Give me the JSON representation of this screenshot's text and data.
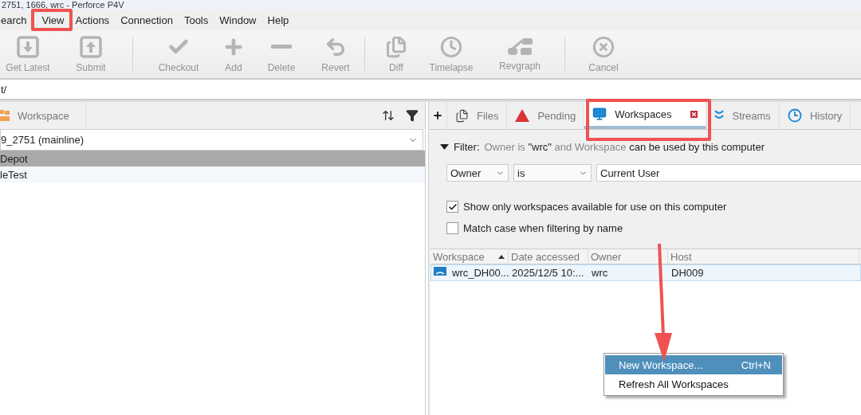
{
  "window": {
    "title": "2751, 1666, wrc - Perforce P4V"
  },
  "menu": [
    {
      "label": "earch",
      "annotated": false
    },
    {
      "label": "View",
      "annotated": true
    },
    {
      "label": "Actions",
      "annotated": false
    },
    {
      "label": "Connection",
      "annotated": false
    },
    {
      "label": "Tools",
      "annotated": false
    },
    {
      "label": "Window",
      "annotated": false
    },
    {
      "label": "Help",
      "annotated": false
    }
  ],
  "toolbar": [
    {
      "kind": "getlatest",
      "label": "Get Latest",
      "disabled": true
    },
    {
      "kind": "submit",
      "label": "Submit",
      "disabled": true
    },
    {
      "kind": "separator"
    },
    {
      "kind": "checkout",
      "label": "Checkout",
      "disabled": true
    },
    {
      "kind": "add",
      "label": "Add",
      "disabled": true
    },
    {
      "kind": "delete",
      "label": "Delete",
      "disabled": true
    },
    {
      "kind": "revert",
      "label": "Revert",
      "disabled": true
    },
    {
      "kind": "separator"
    },
    {
      "kind": "diff",
      "label": "Diff",
      "disabled": true
    },
    {
      "kind": "timelapse",
      "label": "Timelapse",
      "disabled": true
    },
    {
      "kind": "revgraph",
      "label": "Revgraph",
      "disabled": true
    },
    {
      "kind": "separator"
    },
    {
      "kind": "cancel",
      "label": "Cancel",
      "disabled": true
    }
  ],
  "address": {
    "value": "t/"
  },
  "left_pane": {
    "tab": "Workspace",
    "workspace_select": "9_2751 (mainline)",
    "tree": [
      {
        "label": "Depot",
        "selected": true
      },
      {
        "label": "leTest",
        "selected": false
      }
    ]
  },
  "right_pane": {
    "tabs": [
      {
        "kind": "files",
        "label": "Files",
        "selected": false,
        "annotated": false
      },
      {
        "kind": "pending",
        "label": "Pending",
        "selected": false,
        "annotated": false
      },
      {
        "kind": "workspaces",
        "label": "Workspaces",
        "selected": true,
        "annotated": true
      },
      {
        "kind": "streams",
        "label": "Streams",
        "selected": false,
        "annotated": false
      },
      {
        "kind": "history",
        "label": "History",
        "selected": false,
        "annotated": false
      }
    ],
    "filter": {
      "label": "Filter:",
      "expanded": true,
      "description": [
        {
          "text": "Owner is ",
          "dim": true
        },
        {
          "text": "\"wrc\"",
          "dim": false
        },
        {
          "text": " and Workspace ",
          "dim": true
        },
        {
          "text": "can be used by this computer",
          "dim": false
        }
      ],
      "field": "Owner",
      "operator": "is",
      "value": "Current User",
      "options": [
        {
          "label": "Show only workspaces available for use on this computer",
          "checked": true
        },
        {
          "label": "Match case when filtering by name",
          "checked": false
        }
      ]
    },
    "table": {
      "columns": [
        {
          "label": "Workspace",
          "sorted": true
        },
        {
          "label": "Date accessed",
          "sorted": false
        },
        {
          "label": "Owner",
          "sorted": false
        },
        {
          "label": "Host",
          "sorted": false
        }
      ],
      "rows": [
        {
          "cells": [
            "wrc_DH00...",
            "2025/12/5 10:...",
            "wrc",
            "DH009"
          ],
          "selected": true
        }
      ]
    }
  },
  "context_menu": [
    {
      "label": "New Workspace...",
      "shortcut": "Ctrl+N",
      "highlighted": true
    },
    {
      "label": "Refresh All Workspaces",
      "highlighted": false
    }
  ],
  "annotation_arrow": true
}
